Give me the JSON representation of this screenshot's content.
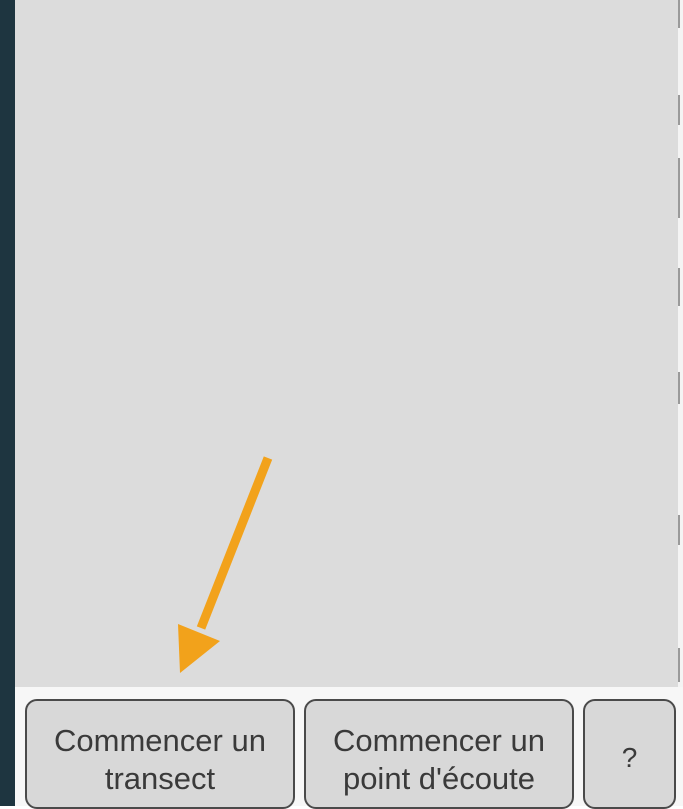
{
  "buttons": {
    "start_transect": {
      "line1": "Commencer un",
      "line2": "transect"
    },
    "start_listening_point": {
      "line1": "Commencer un",
      "line2": "point d'écoute"
    },
    "help": {
      "label": "?"
    }
  },
  "annotation": {
    "arrow_color": "#f2a21b"
  }
}
